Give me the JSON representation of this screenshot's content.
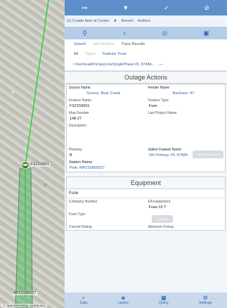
{
  "map": {
    "labels": {
      "feature": "FS2159001",
      "pole": "MP215900027",
      "osm": "© OpenStreetMap contributors"
    }
  },
  "toolbar_top": {
    "icons": [
      "search-icon",
      "star-icon",
      "info-icon",
      "gear-icon",
      "layers-icon",
      "check-icon",
      "close-icon"
    ]
  },
  "action_bar": {
    "create_item": "[1] Create Item at Center",
    "recent": "Recent",
    "actions": "Actions"
  },
  "search_tabs": {
    "search": "Search",
    "item_actions": "Item Actions",
    "trace_results": "Trace Results"
  },
  "filter_tabs": {
    "all": "All",
    "types": "Types",
    "feature": "Feature: Fuse"
  },
  "breadcrumb": {
    "text": "OverheadPrimaryLineSinglePhase PL.97484...",
    "dash": "—"
  },
  "outage": {
    "title": "Outage Actions",
    "source_name_label": "Source Name",
    "source_name": "Source: Bear Creek",
    "feeder_name_label": "Feeder Name",
    "feeder_name": "Recloser: 47",
    "feature_name_label": "Feature Name",
    "feature_name": "FS2159001",
    "feature_type_label": "Feature Type",
    "feature_type": "Fuse",
    "map_number_label": "Map Number",
    "map_number": "148-27",
    "last_project_label": "Last Project Name",
    "description_label": "Description",
    "phasing_label": "Phasing",
    "phasing": "B",
    "upline_label": "Upline Feature Name",
    "upline": "OH Primary: PL.97484",
    "download_btn": "Open Download",
    "station_label": "Station Name",
    "station": "Pole: MP215900027"
  },
  "equipment": {
    "title": "Equipment",
    "type": "Fuse",
    "company_number_label": "Company Number",
    "ea_equipment_label": "EA Equipment",
    "ea_equipment": "Fuse-15 T",
    "fuse_type_label": "Fuse Type",
    "lookup_btn": "In Stores",
    "current_rating_label": "Current Rating",
    "min_pickup_label": "Minimum Pickup"
  },
  "bottom_nav": [
    {
      "label": "Data",
      "icon": "search-icon"
    },
    {
      "label": "Layers",
      "icon": "layers-icon"
    },
    {
      "label": "Query",
      "icon": "table-icon"
    },
    {
      "label": "Settings",
      "icon": "settings-icon"
    }
  ],
  "colors": {
    "accent": "#2e64ad",
    "header": "#5d8fc8",
    "line": "#2bd42b"
  }
}
